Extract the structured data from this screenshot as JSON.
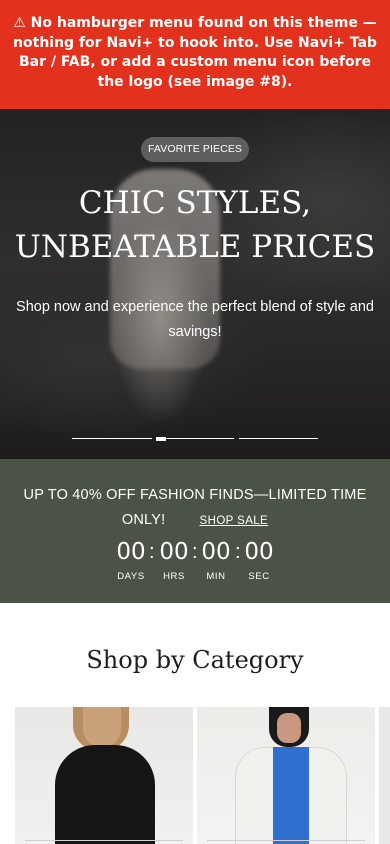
{
  "warning": {
    "text": "⚠ No hamburger menu found on this theme — nothing for Navi+ to hook into. Use Navi+ Tab Bar / FAB, or add a custom menu icon before the logo (see image #8)."
  },
  "hero": {
    "badge": "FAVORITE PIECES",
    "title_line1": "CHIC STYLES,",
    "title_line2": "UNBEATABLE PRICES",
    "subtitle": "Shop now and experience the perfect blend of style and savings!",
    "slides_count": 3,
    "active_slide": 1
  },
  "sale": {
    "headline": "UP TO 40% OFF FASHION FINDS—LIMITED TIME ONLY!",
    "link_label": "SHOP SALE",
    "countdown": [
      {
        "value": "00",
        "label": "DAYS"
      },
      {
        "value": "00",
        "label": "HRS"
      },
      {
        "value": "00",
        "label": "MIN"
      },
      {
        "value": "00",
        "label": "SEC"
      }
    ],
    "separator": ":"
  },
  "categories": {
    "title": "Shop by Category"
  },
  "colors": {
    "warning_bg": "#e2311c",
    "sale_bg": "#4b5347",
    "badge_bg": "#5e5e5e"
  }
}
